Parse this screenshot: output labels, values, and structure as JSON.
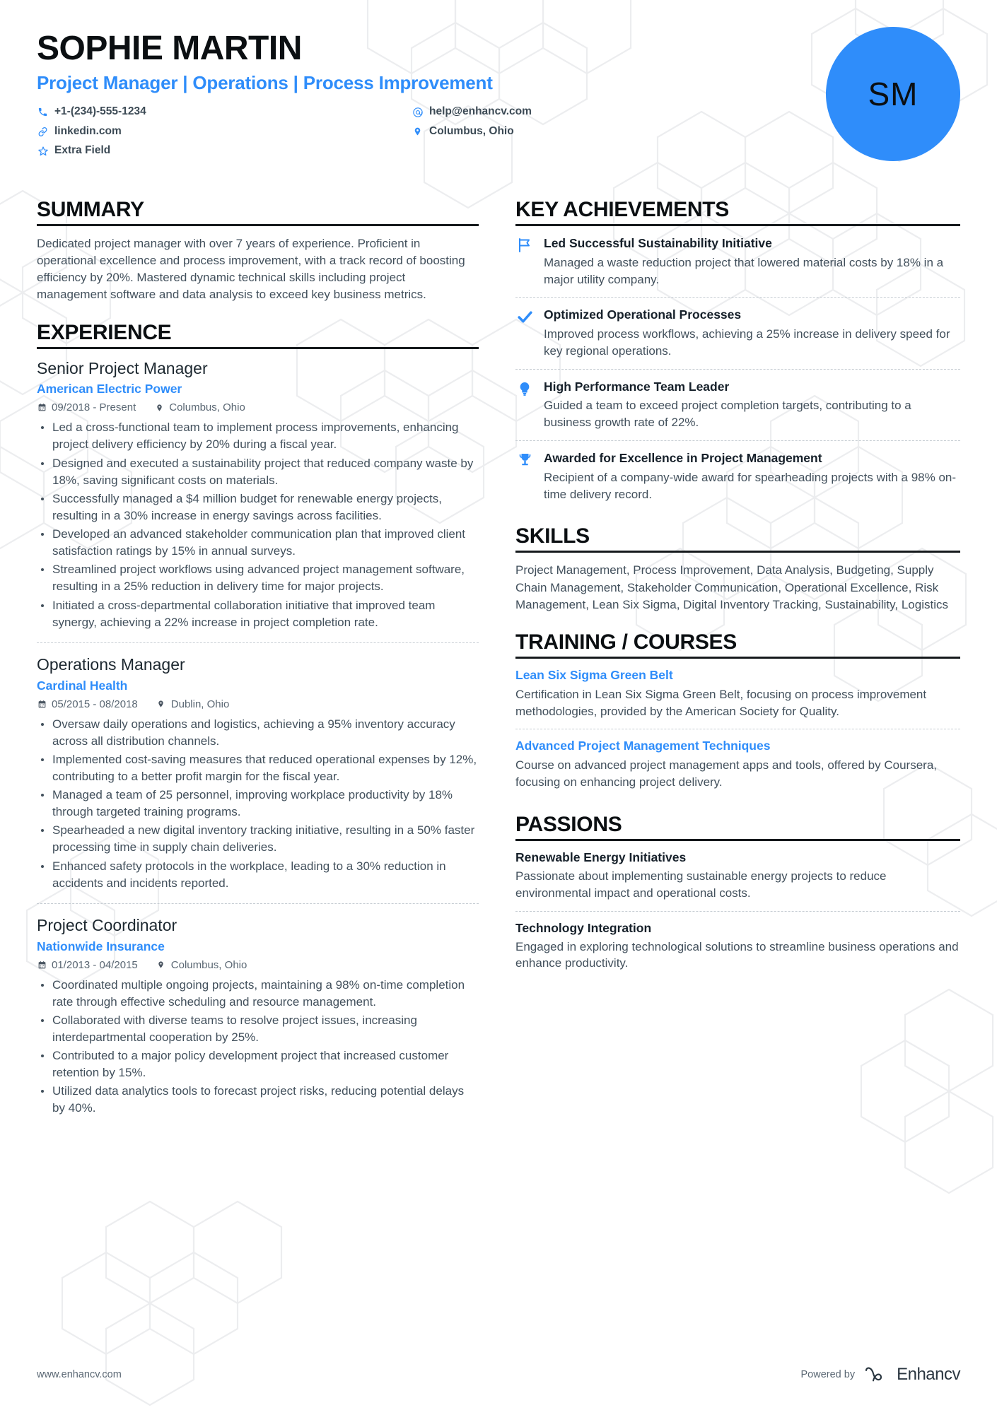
{
  "header": {
    "name": "SOPHIE MARTIN",
    "headline": "Project Manager | Operations | Process Improvement",
    "initials": "SM",
    "contacts": [
      {
        "icon": "phone-icon",
        "value": "+1-(234)-555-1234"
      },
      {
        "icon": "email-icon",
        "value": "help@enhancv.com"
      },
      {
        "icon": "link-icon",
        "value": "linkedin.com"
      },
      {
        "icon": "location-icon",
        "value": "Columbus, Ohio"
      },
      {
        "icon": "star-icon",
        "value": "Extra Field"
      }
    ]
  },
  "summary": {
    "title": "SUMMARY",
    "text": "Dedicated project manager with over 7 years of experience. Proficient in operational excellence and process improvement, with a track record of boosting efficiency by 20%. Mastered dynamic technical skills including project management software and data analysis to exceed key business metrics."
  },
  "experience": {
    "title": "EXPERIENCE",
    "jobs": [
      {
        "role": "Senior Project Manager",
        "company": "American Electric Power",
        "dates": "09/2018 - Present",
        "location": "Columbus, Ohio",
        "bullets": [
          "Led a cross-functional team to implement process improvements, enhancing project delivery efficiency by 20% during a fiscal year.",
          "Designed and executed a sustainability project that reduced company waste by 18%, saving significant costs on materials.",
          "Successfully managed a $4 million budget for renewable energy projects, resulting in a 30% increase in energy savings across facilities.",
          "Developed an advanced stakeholder communication plan that improved client satisfaction ratings by 15% in annual surveys.",
          "Streamlined project workflows using advanced project management software, resulting in a 25% reduction in delivery time for major projects.",
          "Initiated a cross-departmental collaboration initiative that improved team synergy, achieving a 22% increase in project completion rate."
        ]
      },
      {
        "role": "Operations Manager",
        "company": "Cardinal Health",
        "dates": "05/2015 - 08/2018",
        "location": "Dublin, Ohio",
        "bullets": [
          "Oversaw daily operations and logistics, achieving a 95% inventory accuracy across all distribution channels.",
          "Implemented cost-saving measures that reduced operational expenses by 12%, contributing to a better profit margin for the fiscal year.",
          "Managed a team of 25 personnel, improving workplace productivity by 18% through targeted training programs.",
          "Spearheaded a new digital inventory tracking initiative, resulting in a 50% faster processing time in supply chain deliveries.",
          "Enhanced safety protocols in the workplace, leading to a 30% reduction in accidents and incidents reported."
        ]
      },
      {
        "role": "Project Coordinator",
        "company": "Nationwide Insurance",
        "dates": "01/2013 - 04/2015",
        "location": "Columbus, Ohio",
        "bullets": [
          "Coordinated multiple ongoing projects, maintaining a 98% on-time completion rate through effective scheduling and resource management.",
          "Collaborated with diverse teams to resolve project issues, increasing interdepartmental cooperation by 25%.",
          "Contributed to a major policy development project that increased customer retention by 15%.",
          "Utilized data analytics tools to forecast project risks, reducing potential delays by 40%."
        ]
      }
    ]
  },
  "achievements": {
    "title": "KEY ACHIEVEMENTS",
    "items": [
      {
        "icon": "flag-icon",
        "title": "Led Successful Sustainability Initiative",
        "desc": "Managed a waste reduction project that lowered material costs by 18% in a major utility company."
      },
      {
        "icon": "check-icon",
        "title": "Optimized Operational Processes",
        "desc": "Improved process workflows, achieving a 25% increase in delivery speed for key regional operations."
      },
      {
        "icon": "lightbulb-icon",
        "title": "High Performance Team Leader",
        "desc": "Guided a team to exceed project completion targets, contributing to a business growth rate of 22%."
      },
      {
        "icon": "trophy-icon",
        "title": "Awarded for Excellence in Project Management",
        "desc": "Recipient of a company-wide award for spearheading projects with a 98% on-time delivery record."
      }
    ]
  },
  "skills": {
    "title": "SKILLS",
    "text": "Project Management, Process Improvement, Data Analysis, Budgeting, Supply Chain Management, Stakeholder Communication, Operational Excellence, Risk Management, Lean Six Sigma, Digital Inventory Tracking, Sustainability, Logistics"
  },
  "training": {
    "title": "TRAINING / COURSES",
    "items": [
      {
        "name": "Lean Six Sigma Green Belt",
        "desc": "Certification in Lean Six Sigma Green Belt, focusing on process improvement methodologies, provided by the American Society for Quality."
      },
      {
        "name": "Advanced Project Management Techniques",
        "desc": "Course on advanced project management apps and tools, offered by Coursera, focusing on enhancing project delivery."
      }
    ]
  },
  "passions": {
    "title": "PASSIONS",
    "items": [
      {
        "name": "Renewable Energy Initiatives",
        "desc": "Passionate about implementing sustainable energy projects to reduce environmental impact and operational costs."
      },
      {
        "name": "Technology Integration",
        "desc": "Engaged in exploring technological solutions to streamline business operations and enhance productivity."
      }
    ]
  },
  "footer": {
    "url": "www.enhancv.com",
    "powered_by": "Powered by",
    "brand": "Enhancv"
  },
  "colors": {
    "accent": "#2f8dfa",
    "text": "#42505c",
    "heading": "#0b0f12",
    "rule": "#15191c",
    "watermark": "#eceef0"
  }
}
